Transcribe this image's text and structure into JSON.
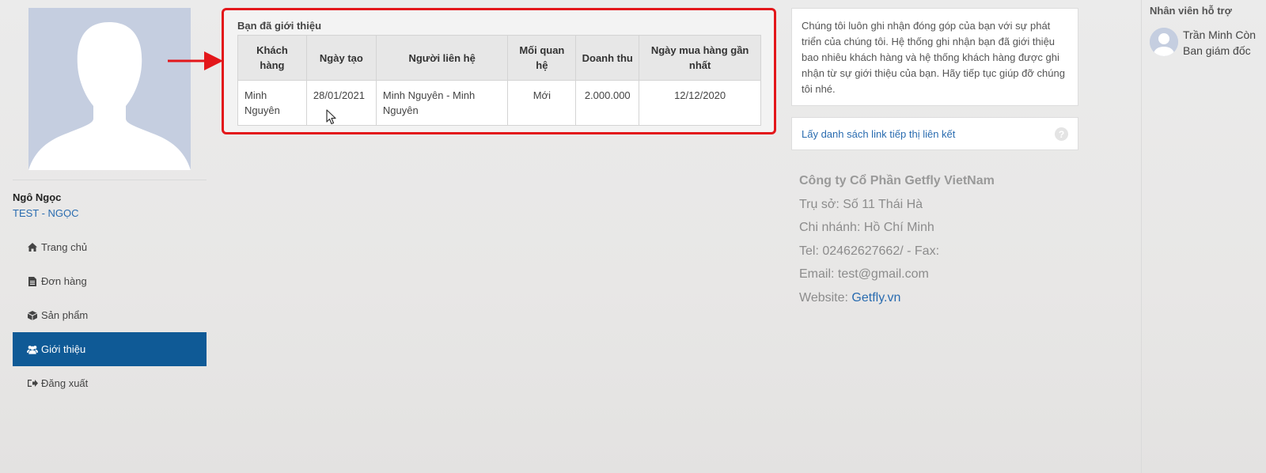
{
  "user": {
    "name": "Ngô Ngọc",
    "company": "TEST - NGỌC"
  },
  "nav": {
    "items": [
      {
        "label": "Trang chủ",
        "icon": "home-icon"
      },
      {
        "label": "Đơn hàng",
        "icon": "file-icon"
      },
      {
        "label": "Sản phẩm",
        "icon": "cube-icon"
      },
      {
        "label": "Giới thiệu",
        "icon": "users-icon",
        "active": true
      },
      {
        "label": "Đăng xuất",
        "icon": "sign-out-icon"
      }
    ]
  },
  "referrals": {
    "title": "Bạn đã giới thiệu",
    "columns": [
      "Khách hàng",
      "Ngày tạo",
      "Người liên hệ",
      "Mối quan hệ",
      "Doanh thu",
      "Ngày mua hàng gần nhất"
    ],
    "rows": [
      {
        "customer": "Minh Nguyên",
        "created": "28/01/2021",
        "contact": "Minh Nguyên - Minh Nguyên",
        "relation": "Mới",
        "revenue": "2.000.000",
        "last_purchase": "12/12/2020"
      }
    ]
  },
  "info": {
    "text": "Chúng tôi luôn ghi nhận đóng góp của bạn với sự phát triển của chúng tôi. Hệ thống ghi nhận bạn đã giới thiệu bao nhiêu khách hàng và hệ thống khách hàng được ghi nhận từ sự giới thiệu của bạn. Hãy tiếp tục giúp đỡ chúng tôi nhé.",
    "link_label": "Lấy danh sách link tiếp thị liên kết",
    "help_glyph": "?"
  },
  "company": {
    "name": "Công ty Cổ Phần Getfly VietNam",
    "hq": "Trụ sở: Số 11 Thái Hà",
    "branch": "Chi nhánh: Hồ Chí Minh",
    "tel": "Tel: 02462627662/ - Fax:",
    "email": "Email: test@gmail.com",
    "website_label": "Website: ",
    "website_link": "Getfly.vn"
  },
  "support": {
    "title": "Nhân viên hỗ trợ",
    "name": "Trần Minh Còn",
    "role": "Ban giám đốc"
  },
  "colors": {
    "active_nav": "#0f5a96",
    "highlight_border": "#e3171b",
    "link": "#2a6cb0"
  }
}
